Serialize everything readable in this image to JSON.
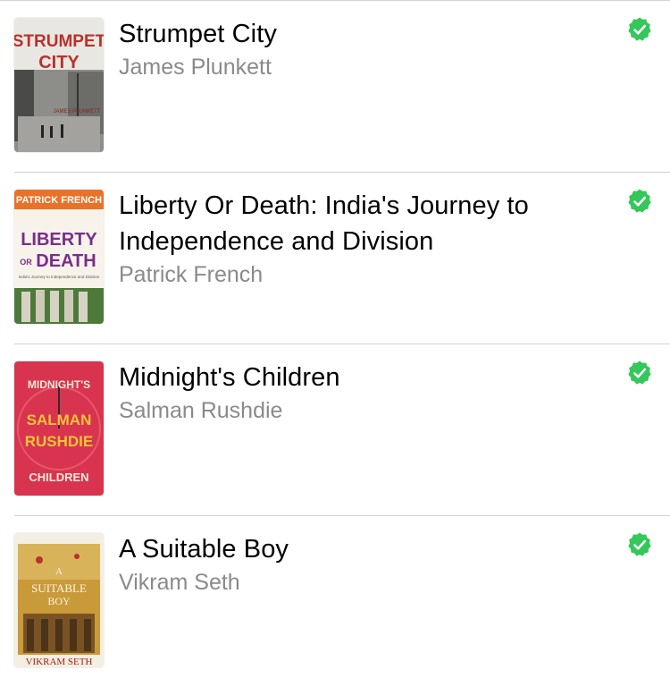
{
  "books": [
    {
      "title": "Strumpet City",
      "author": "James Plunkett",
      "cover_title": [
        "STRUMPET",
        "CITY"
      ],
      "cover_author": "JAMES PLUNKETT",
      "status_icon": "downloaded-check-icon"
    },
    {
      "title": "Liberty Or Death: India's Journey to Independence and Division",
      "author": "Patrick French",
      "cover_author": "PATRICK FRENCH",
      "cover_title": [
        "LIBERTY",
        "OR",
        "DEATH"
      ],
      "cover_subtitle": "India's Journey to Independence and Division",
      "status_icon": "downloaded-check-icon"
    },
    {
      "title": "Midnight's Children",
      "author": "Salman Rushdie",
      "cover_title": [
        "MIDNIGHT'S",
        "CHILDREN"
      ],
      "cover_author": [
        "SALMAN",
        "RUSHDIE"
      ],
      "status_icon": "downloaded-check-icon"
    },
    {
      "title": "A Suitable Boy",
      "author": "Vikram Seth",
      "cover_title": [
        "A",
        "SUITABLE",
        "BOY"
      ],
      "cover_author": "VIKRAM SETH",
      "status_icon": "downloaded-check-icon"
    }
  ],
  "colors": {
    "check": "#34c759",
    "author_text": "#8a8a8e",
    "separator": "#d1d1d6"
  }
}
